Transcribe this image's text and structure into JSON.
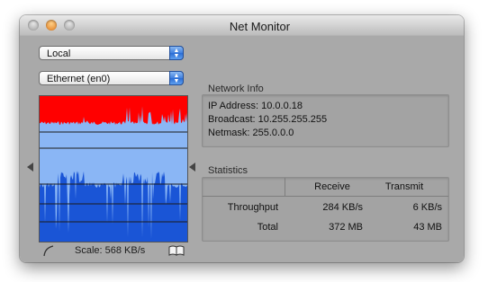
{
  "window": {
    "title": "Net Monitor"
  },
  "controls": {
    "host_select": {
      "value": "Local"
    },
    "interface_select": {
      "value": "Ethernet (en0)"
    }
  },
  "graph": {
    "scale_label": "Scale: 568 KB/s"
  },
  "network_info": {
    "heading": "Network Info",
    "lines": [
      "IP Address: 10.0.0.18",
      "Broadcast: 10.255.255.255",
      "Netmask: 255.0.0.0"
    ]
  },
  "statistics": {
    "heading": "Statistics",
    "columns": [
      "Receive",
      "Transmit"
    ],
    "rows": [
      {
        "label": "Throughput",
        "receive": "284 KB/s",
        "transmit": "6 KB/s"
      },
      {
        "label": "Total",
        "receive": "372 MB",
        "transmit": "43 MB"
      }
    ]
  },
  "colors": {
    "transmit_graph": "#ff0000",
    "receive_graph": "#1a55d6",
    "graph_background": "#8ab6f5"
  }
}
